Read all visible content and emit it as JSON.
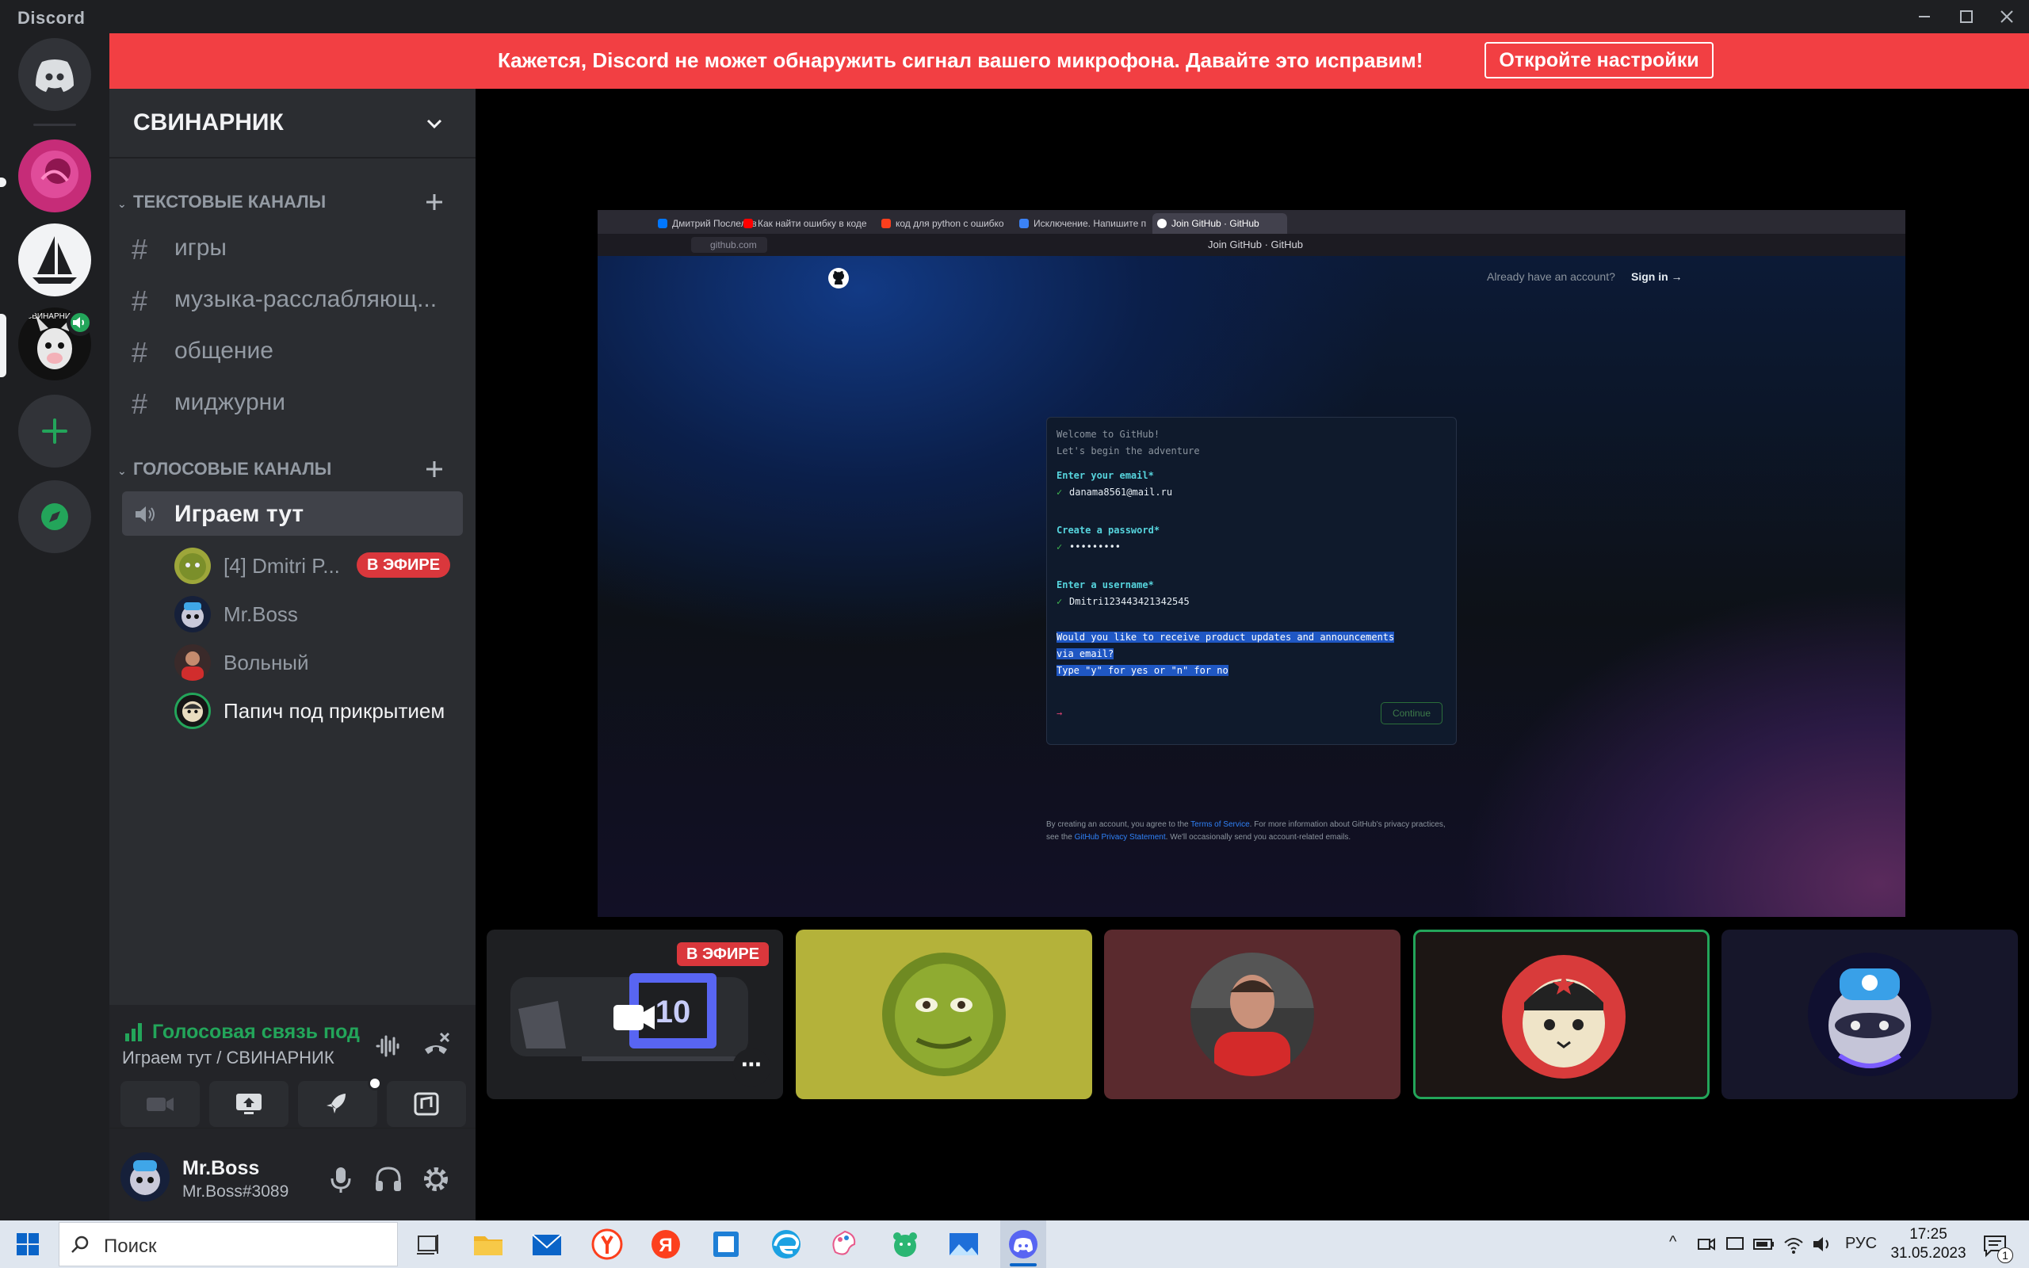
{
  "app": {
    "name": "Discord"
  },
  "banner": {
    "message": "Кажется, Discord не может обнаружить сигнал вашего микрофона. Давайте это исправим!",
    "button_label": "Откройте настройки"
  },
  "server": {
    "name": "СВИНАРНИК",
    "text_category": "ТЕКСТОВЫЕ КАНАЛЫ",
    "voice_category": "ГОЛОСОВЫЕ КАНАЛЫ",
    "text_channels": [
      "игры",
      "музыка-расслабляющ...",
      "общение",
      "миджурни"
    ],
    "voice_channel": "Играем тут",
    "members": [
      {
        "name": "[4] Dmitri P...",
        "badge": "В ЭФИРЕ"
      },
      {
        "name": "Mr.Boss"
      },
      {
        "name": "Вольный"
      },
      {
        "name": "Папич под прикрытием"
      }
    ]
  },
  "voice_panel": {
    "status": "Голосовая связь под",
    "location": "Играем тут / СВИНАРНИК"
  },
  "user": {
    "name": "Mr.Boss",
    "tag": "Mr.Boss#3089"
  },
  "stream": {
    "tabs": [
      "Дмитрий Послелов",
      "Как найти ошибку в коде",
      "код для python с ошибко",
      "Исключение. Напишите п",
      "Join GitHub · GitHub"
    ],
    "url": "github.com",
    "page_title": "Join GitHub · GitHub",
    "have_account": "Already have an account?",
    "sign_in": "Sign in →",
    "welcome": "Welcome to GitHub!",
    "adventure": "Let's begin the adventure",
    "email_label": "Enter your email*",
    "email_value": "danama8561@mail.ru",
    "password_label": "Create a password*",
    "password_value": "•••••••••",
    "username_label": "Enter a username*",
    "username_value": "Dmitri123443421342545",
    "prompt_line1": "Would you like to receive product updates and announcements",
    "prompt_line2": "via email?",
    "prompt_line3": "Type \"y\" for yes or \"n\" for no",
    "prompt_arrow": "→",
    "continue": "Continue",
    "footer_1": "By creating an account, you agree to the ",
    "footer_terms": "Terms of Service",
    "footer_2": ". For more information about GitHub's privacy practices,",
    "footer_3": "see the ",
    "footer_privacy": "GitHub Privacy Statement",
    "footer_4": ". We'll occasionally send you account-related emails."
  },
  "tiles": {
    "live_badge": "В ЭФИРЕ",
    "more": "⋯"
  },
  "taskbar": {
    "search_placeholder": "Поиск",
    "lang": "РУС",
    "time": "17:25",
    "date": "31.05.2023",
    "notifications": "1"
  },
  "colors": {
    "banner": "#f23f43",
    "voice_green": "#23a55a",
    "live_red": "#da373c",
    "speaking_border": "#23a55a"
  },
  "icons": [
    "discord-home-icon",
    "add-server-icon",
    "explore-icon",
    "hash-icon",
    "speaker-icon",
    "camera-icon",
    "share-screen-icon",
    "activity-icon",
    "soundboard-icon",
    "microphone-icon",
    "headphones-icon",
    "settings-icon",
    "disconnect-icon",
    "noise-suppression-icon"
  ]
}
